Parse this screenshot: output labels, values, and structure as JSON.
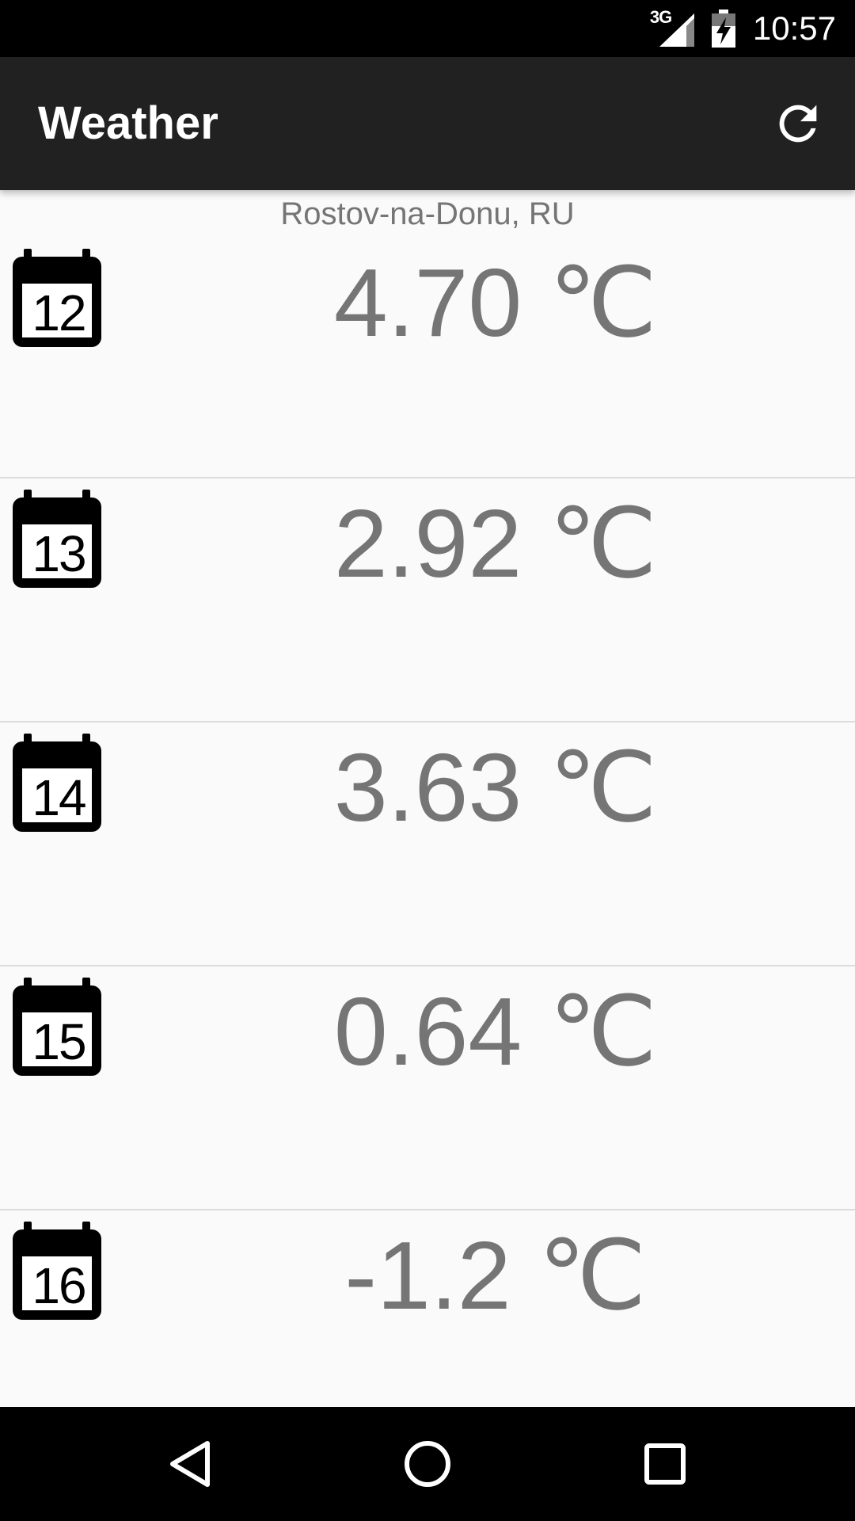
{
  "status_bar": {
    "network": "3G",
    "time": "10:57",
    "icons": [
      "signal-icon",
      "battery-charging-icon"
    ]
  },
  "toolbar": {
    "title": "Weather",
    "refresh_icon": "refresh-icon"
  },
  "location": "Rostov-na-Donu, RU",
  "forecast": [
    {
      "day": "12",
      "temperature": "4.70 ℃"
    },
    {
      "day": "13",
      "temperature": "2.92 ℃"
    },
    {
      "day": "14",
      "temperature": "3.63 ℃"
    },
    {
      "day": "15",
      "temperature": "0.64 ℃"
    },
    {
      "day": "16",
      "temperature": "-1.2 ℃"
    }
  ],
  "nav_bar": {
    "icons": [
      "back-icon",
      "home-icon",
      "recents-icon"
    ]
  }
}
